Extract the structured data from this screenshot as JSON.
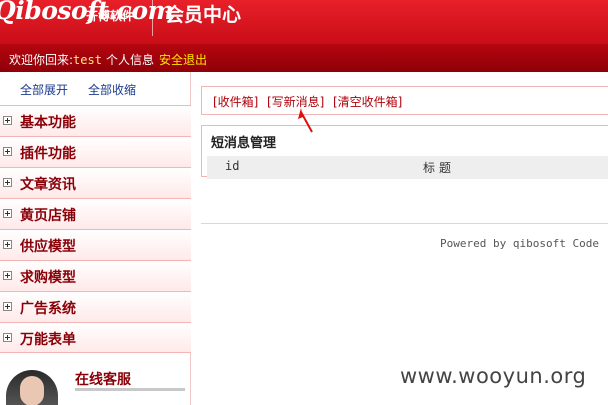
{
  "header": {
    "logo_main": "Qibosoft.com",
    "logo_sub": "齐博软件",
    "title": "会员中心"
  },
  "userbar": {
    "welcome_prefix": "欢迎你回来:",
    "username": "test",
    "user_info": "个人信息",
    "logout": "安全退出"
  },
  "sidebar": {
    "expand_all": "全部展开",
    "collapse_all": "全部收缩",
    "items": [
      {
        "label": "基本功能"
      },
      {
        "label": "插件功能"
      },
      {
        "label": "文章资讯"
      },
      {
        "label": "黄页店铺"
      },
      {
        "label": "供应模型"
      },
      {
        "label": "求购模型"
      },
      {
        "label": "广告系统"
      },
      {
        "label": "万能表单"
      }
    ],
    "service_title": "在线客服"
  },
  "main": {
    "links": {
      "inbox": "[收件箱]",
      "compose": "[写新消息]",
      "clear": "[清空收件箱]"
    },
    "panel_title": "短消息管理",
    "columns": {
      "id": "id",
      "title": "标题"
    },
    "powered": "Powered by qibosoft Code"
  },
  "watermark": "www.wooyun.org",
  "colors": {
    "header_red": "#d9141e",
    "userbar_red": "#a0030c",
    "menu_text": "#8a0008",
    "logout_yellow": "#ffe600"
  },
  "icons": [
    "plus-box-icon",
    "arrow-icon"
  ]
}
